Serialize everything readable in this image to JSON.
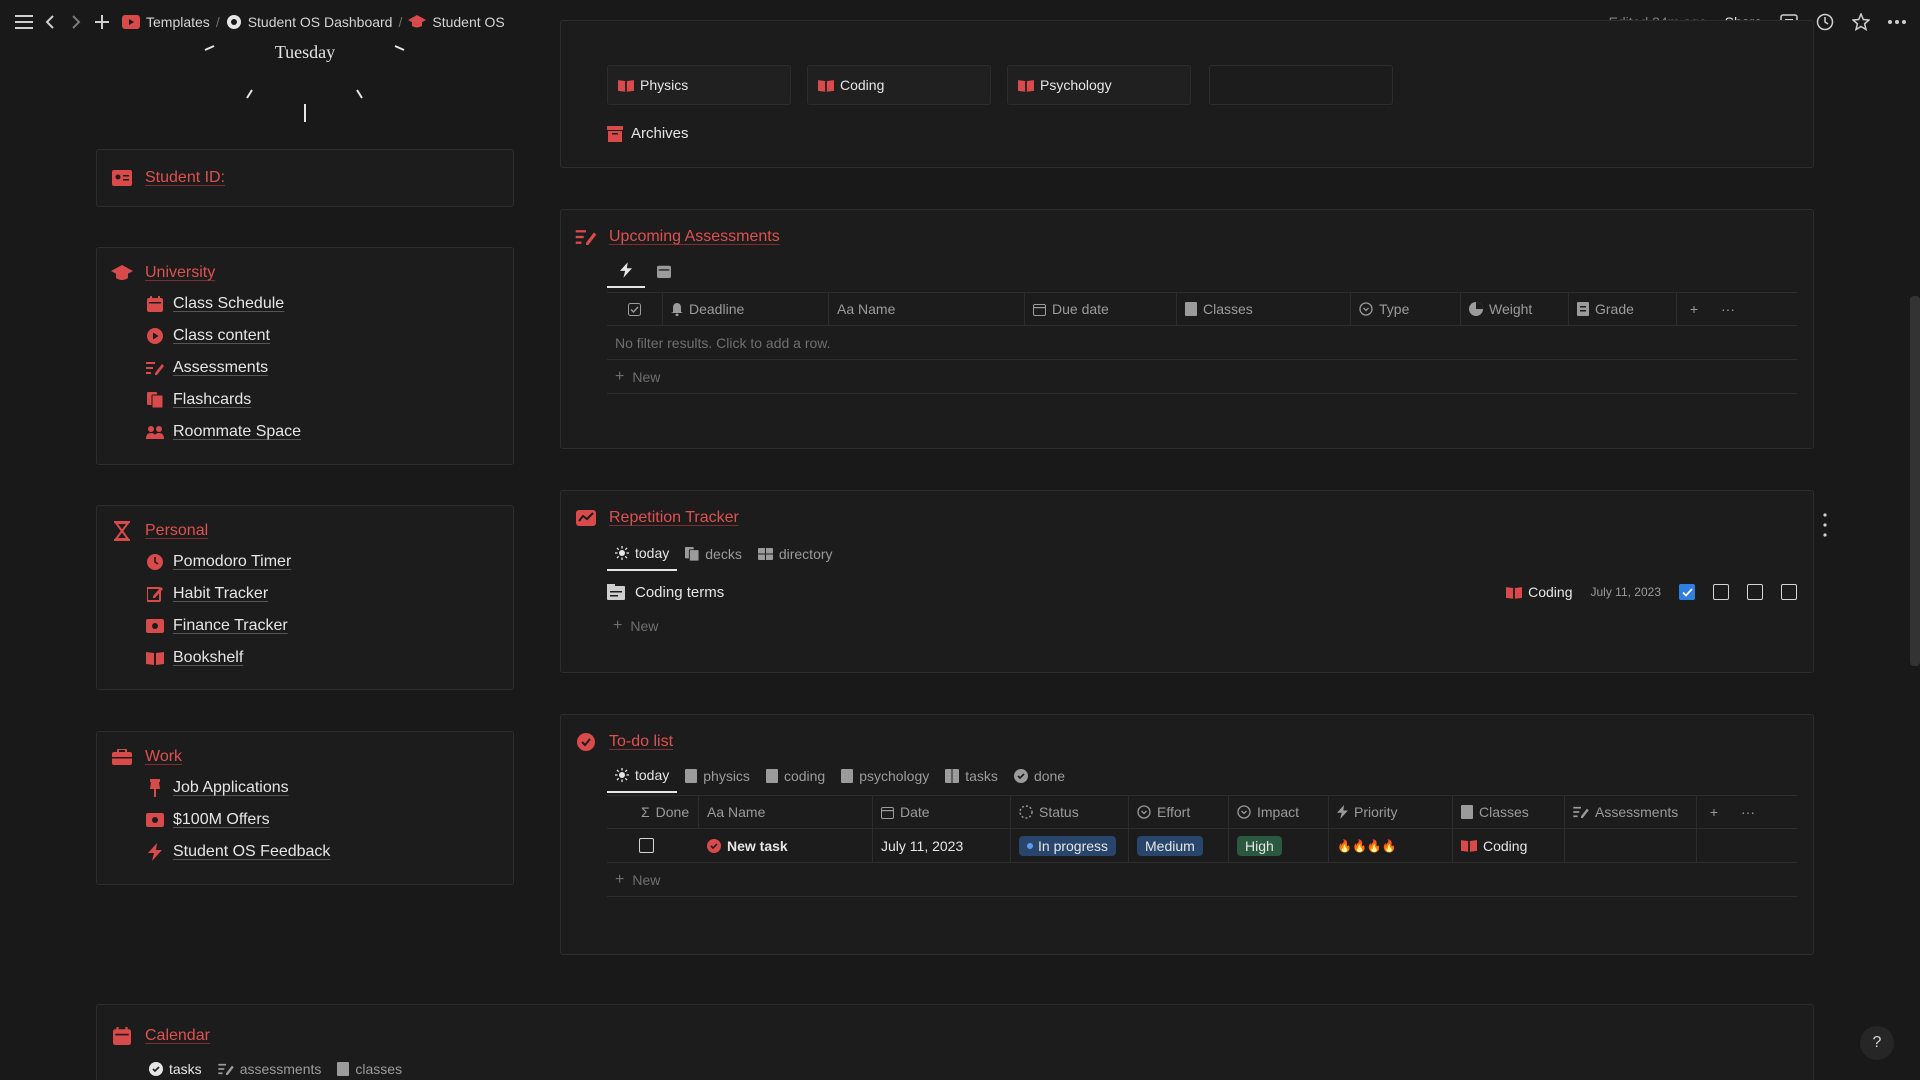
{
  "topbar": {
    "breadcrumbs": [
      "Templates",
      "Student OS Dashboard",
      "Student OS"
    ],
    "edited": "Edited 34m ago",
    "share": "Share"
  },
  "clock": {
    "day": "Tuesday"
  },
  "student_id": {
    "label": "Student ID:"
  },
  "university": {
    "title": "University",
    "items": [
      "Class Schedule",
      "Class content",
      "Assessments",
      "Flashcards",
      "Roommate Space"
    ]
  },
  "personal": {
    "title": "Personal",
    "items": [
      "Pomodoro Timer",
      "Habit Tracker",
      "Finance Tracker",
      "Bookshelf"
    ]
  },
  "work": {
    "title": "Work",
    "items": [
      "Job Applications",
      "$100M Offers",
      "Student OS Feedback"
    ]
  },
  "classes": {
    "cards": [
      "Physics",
      "Coding",
      "Psychology"
    ],
    "archives": "Archives"
  },
  "assessments": {
    "title": "Upcoming Assessments",
    "columns": [
      "Deadline",
      "Aa Name",
      "Due date",
      "Classes",
      "Type",
      "Weight",
      "Grade"
    ],
    "empty": "No filter results. Click to add a row.",
    "new": "New"
  },
  "repetition": {
    "title": "Repetition Tracker",
    "tabs": [
      "today",
      "decks",
      "directory"
    ],
    "row": {
      "name": "Coding terms",
      "class": "Coding",
      "date": "July 11, 2023"
    },
    "new": "New"
  },
  "todo": {
    "title": "To-do list",
    "tabs": [
      "today",
      "physics",
      "coding",
      "psychology",
      "tasks",
      "done"
    ],
    "columns": [
      "Done",
      "Aa Name",
      "Date",
      "Status",
      "Effort",
      "Impact",
      "Priority",
      "Classes",
      "Assessments"
    ],
    "row": {
      "name": "New task",
      "date": "July 11, 2023",
      "status": "In progress",
      "effort": "Medium",
      "impact": "High",
      "priority": "🔥🔥🔥🔥",
      "class": "Coding"
    },
    "new": "New"
  },
  "calendar": {
    "title": "Calendar",
    "tabs": [
      "tasks",
      "assessments",
      "classes"
    ]
  },
  "help": "?"
}
